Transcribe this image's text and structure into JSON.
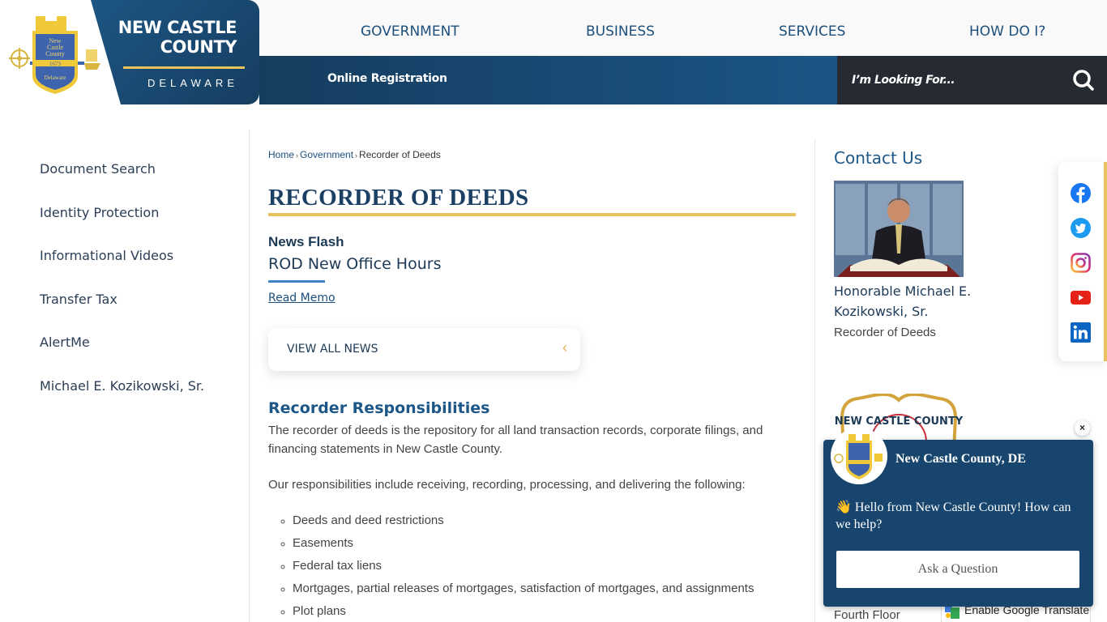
{
  "brand": {
    "title_line1": "NEW CASTLE",
    "title_line2": "COUNTY",
    "subtitle": "DELAWARE",
    "seal_text": [
      "New",
      "Castle",
      "County",
      "1673",
      "Delaware"
    ]
  },
  "topnav": {
    "items": [
      {
        "label": "GOVERNMENT"
      },
      {
        "label": "BUSINESS"
      },
      {
        "label": "SERVICES"
      },
      {
        "label": "HOW DO I?"
      }
    ]
  },
  "subbar": {
    "link": "Online Registration"
  },
  "search": {
    "placeholder": "I’m Looking For...",
    "value": "",
    "icon": "search-icon"
  },
  "sidebar": {
    "items": [
      {
        "label": "Document Search"
      },
      {
        "label": "Identity Protection"
      },
      {
        "label": "Informational Videos"
      },
      {
        "label": "Transfer Tax"
      },
      {
        "label": "AlertMe"
      },
      {
        "label": "Michael E. Kozikowski, Sr."
      }
    ]
  },
  "breadcrumb": {
    "items": [
      "Home",
      "Government",
      "Recorder of Deeds"
    ],
    "separator": "›"
  },
  "main": {
    "page_title": "RECORDER OF DEEDS",
    "news": {
      "label": "News Flash",
      "title": "ROD New Office Hours",
      "link": "Read Memo",
      "view_all": "VIEW ALL NEWS",
      "view_all_icon": "‹"
    },
    "section_title": "Recorder Responsibilities",
    "paragraph1": "The recorder of deeds is the repository for all land transaction records, corporate filings, and financing statements in New Castle County.",
    "paragraph2": "Our responsibilities include receiving, recording, processing, and delivering the following:",
    "list": [
      "Deeds and deed restrictions",
      "Easements",
      "Federal tax liens",
      "Mortgages, partial releases of mortgages, satisfaction of mortgages, and assignments",
      "Plot plans"
    ]
  },
  "contact": {
    "heading": "Contact Us",
    "name": "Honorable Michael E. Kozikowski, Sr.",
    "role": "Recorder of Deeds",
    "seal_text": "NEW CASTLE COUNTY",
    "address_partial": "Fourth Floor"
  },
  "translate": {
    "label": "Enable Google Translate"
  },
  "social": {
    "items": [
      "facebook",
      "twitter",
      "instagram",
      "youtube",
      "linkedin"
    ]
  },
  "chat": {
    "title": "New Castle County, DE",
    "message": "👋 Hello from New Castle County! How can we help?",
    "button": "Ask a Question",
    "close": "×"
  },
  "colors": {
    "navy": "#17456d",
    "brand_blue": "#1d5787",
    "gold": "#e8c35b",
    "search_bg": "#262b33",
    "facebook": "#1877f2",
    "twitter": "#1d9bf0",
    "youtube": "#e62117",
    "linkedin": "#0a66c2"
  }
}
